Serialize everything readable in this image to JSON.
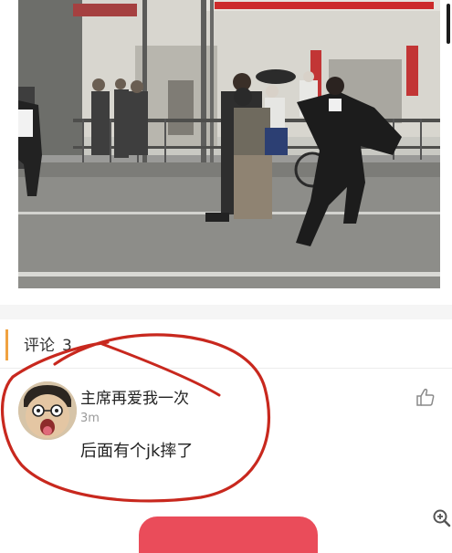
{
  "comments": {
    "label": "评论",
    "count": "3"
  },
  "comment": {
    "username": "主席再爱我一次",
    "time": "3m",
    "text": "后面有个jk摔了"
  },
  "icons": {
    "like": "thumbs-up-icon",
    "zoom": "zoom-in-icon"
  },
  "colors": {
    "accent": "#f0a240",
    "annotation": "#c8281e",
    "primary_button": "#ea4c5a"
  }
}
